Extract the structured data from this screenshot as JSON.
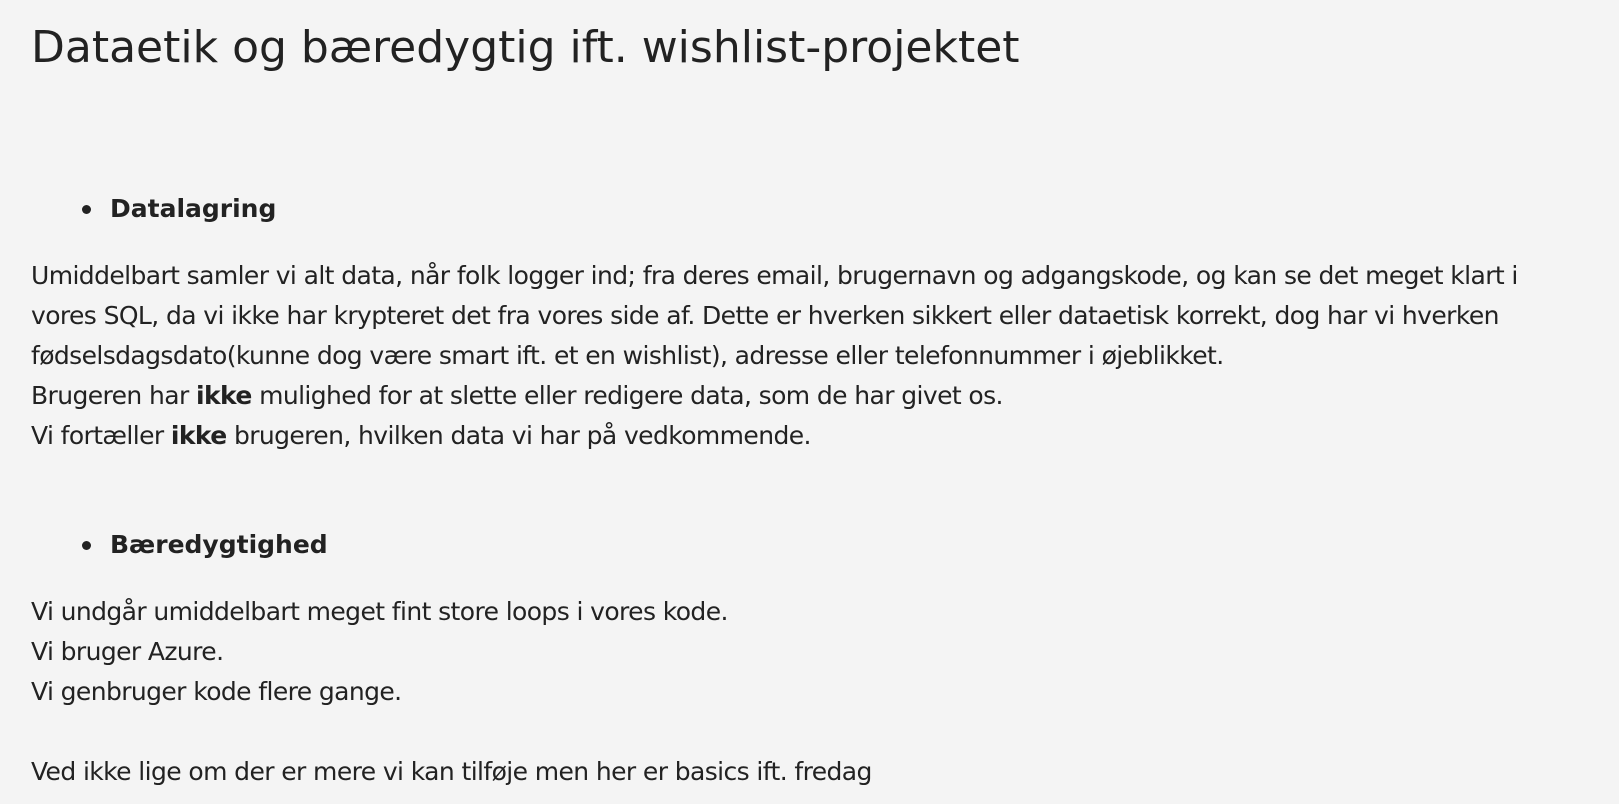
{
  "title": "Dataetik og bæredygtig ift. wishlist-projektet",
  "sections": [
    {
      "heading": "Datalagring",
      "lines": [
        "Umiddelbart samler vi alt data, når folk logger ind; fra deres email, brugernavn og adgangskode, og kan se det meget klart i",
        "vores SQL, da vi ikke har krypteret det fra vores side af. Dette er hverken sikkert eller dataetisk korrekt, dog har vi hverken",
        "fødselsdagsdato(kunne dog være smart ift. et en wishlist), adresse eller telefonnummer i øjeblikket."
      ],
      "line4": {
        "before": "Brugeren har ",
        "bold": "ikke",
        "after": " mulighed for at slette eller redigere data, som de har givet os."
      },
      "line5": {
        "before": "Vi fortæller ",
        "bold": "ikke",
        "after": " brugeren, hvilken data vi har på vedkommende."
      }
    },
    {
      "heading": "Bæredygtighed",
      "lines": [
        "Vi undgår umiddelbart meget fint store loops i vores kode.",
        "Vi bruger Azure.",
        "Vi genbruger kode flere gange."
      ]
    }
  ],
  "footer_note": "Ved ikke lige om der er mere vi kan tilføje men her er basics ift. fredag"
}
